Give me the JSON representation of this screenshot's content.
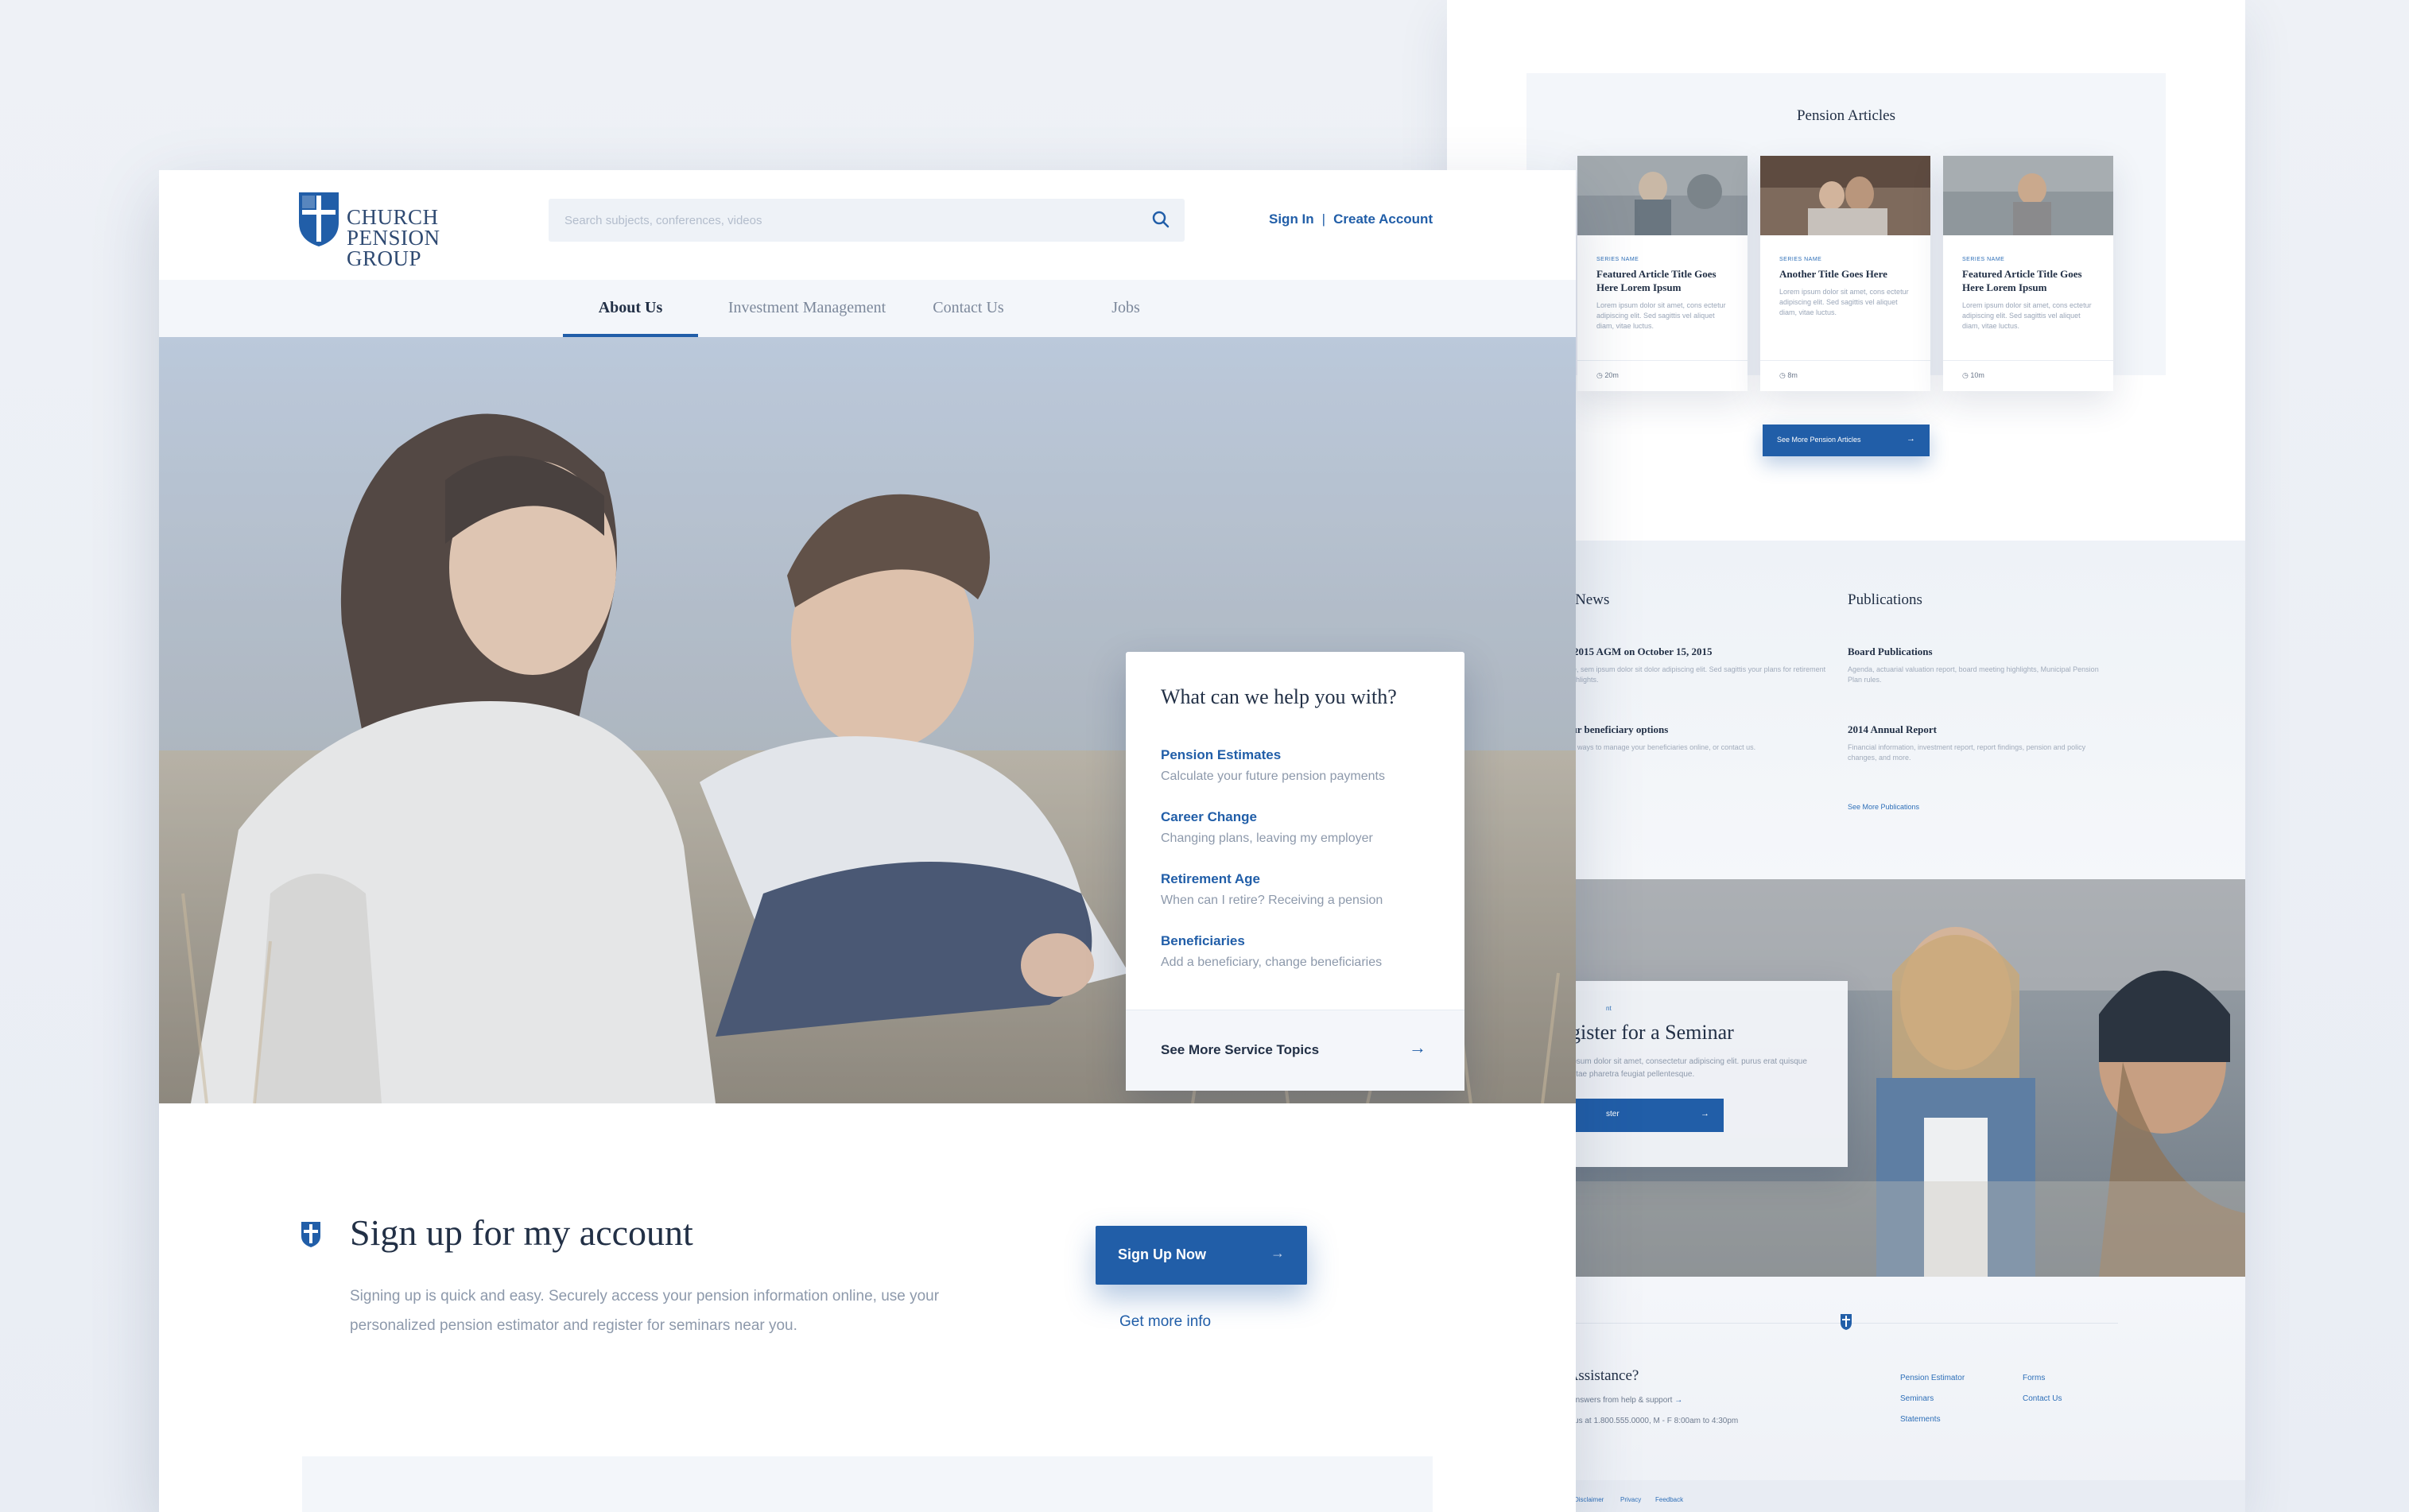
{
  "back": {
    "articles": {
      "title": "Pension Articles",
      "cards": [
        {
          "tag": "SERIES NAME",
          "title": "Featured Article Title Goes Here Lorem Ipsum",
          "text": "Lorem ipsum dolor sit amet, cons ectetur adipiscing elit. Sed sagittis vel aliquet diam, vitae luctus.",
          "time": "20m"
        },
        {
          "tag": "SERIES NAME",
          "title": "Another Title Goes Here",
          "text": "Lorem ipsum dolor sit amet, cons ectetur adipiscing elit. Sed sagittis vel aliquet diam, vitae luctus.",
          "time": "8m"
        },
        {
          "tag": "SERIES NAME",
          "title": "Featured Article Title Goes Here Lorem Ipsum",
          "text": "Lorem ipsum dolor sit amet, cons ectetur adipiscing elit. Sed sagittis vel aliquet diam, vitae luctus.",
          "time": "10m"
        }
      ],
      "button": "See More Pension Articles"
    },
    "news": {
      "title": "r News",
      "items": [
        {
          "title": "e 2015 AGM on October 15, 2015",
          "text": "ore, sem ipsum dolor sit dolor adipiscing elit. Sed sagittis your plans for retirement highlights."
        },
        {
          "title": "our beneficiary options",
          "text": "ew ways to manage your beneficiaries online, or contact us."
        }
      ],
      "link": "s"
    },
    "publications": {
      "title": "Publications",
      "items": [
        {
          "title": "Board Publications",
          "text": "Agenda, actuarial valuation report, board meeting highlights, Municipal Pension Plan rules."
        },
        {
          "title": "2014 Annual Report",
          "text": "Financial information, investment report, report findings, pension and policy changes, and more."
        }
      ],
      "link": "See More Publications"
    },
    "seminar": {
      "small": "nt",
      "title": "gister for a Seminar",
      "text": "ipsum dolor sit amet, consectetur adipiscing elit. purus erat quisque vitae pharetra feugiat pellentesque.",
      "button": "ster"
    },
    "footer": {
      "title": "ed Assistance?",
      "line1": "quick answers from help & support",
      "line2": "ontact us at 1.800.555.0000,   M - F  8:00am to 4:30pm",
      "links_col1": [
        "Pension Estimator",
        "Seminars",
        "Statements"
      ],
      "links_col2": [
        "Forms",
        "Contact Us"
      ],
      "bottom_links": [
        "Disclaimer",
        "Privacy",
        "Feedback"
      ]
    }
  },
  "header": {
    "logo_line1": "CHURCH",
    "logo_line2": "PENSION GROUP",
    "search_placeholder": "Search subjects, conferences, videos",
    "sign_in": "Sign In",
    "separator": "|",
    "create_account": "Create Account"
  },
  "nav": {
    "items": [
      "About Us",
      "Investment Management",
      "Contact Us",
      "Jobs"
    ]
  },
  "help": {
    "title": "What can we help you with?",
    "items": [
      {
        "title": "Pension Estimates",
        "desc": "Calculate your future pension payments"
      },
      {
        "title": "Career Change",
        "desc": "Changing plans, leaving my employer"
      },
      {
        "title": "Retirement Age",
        "desc": "When can I retire? Receiving a pension"
      },
      {
        "title": "Beneficiaries",
        "desc": "Add a beneficiary, change beneficiaries"
      }
    ],
    "more": "See More Service Topics",
    "arrow": "→"
  },
  "signup": {
    "title": "Sign up for my account",
    "desc": "Signing up is quick and easy. Securely access your pension information online, use your personalized pension estimator and register for seminars near you.",
    "button": "Sign Up Now",
    "arrow": "→",
    "more": "Get more info"
  },
  "colors": {
    "brand": "#215ea8",
    "heading": "#223046",
    "muted": "#8d99ab",
    "panel": "#f3f6fa"
  }
}
